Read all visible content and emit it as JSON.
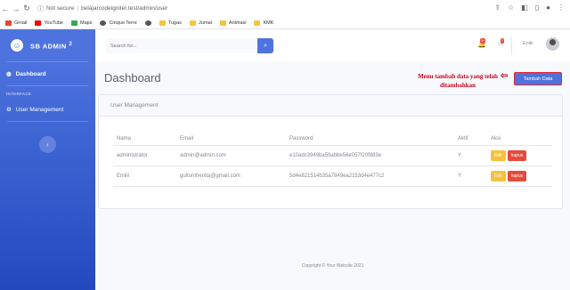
{
  "browser": {
    "security_label": "Not secure",
    "url": "belajarcodeigniter.test/admin/user",
    "bookmarks": [
      "Gmail",
      "YouTube",
      "Maps",
      "Cinque Terre",
      "Tugas",
      "Jurnal",
      "Animasi",
      "KMK"
    ]
  },
  "sidebar": {
    "brand": "SB ADMIN",
    "brand_sup": "2",
    "nav_dashboard": "Dashboard",
    "heading": "INTERFACE",
    "nav_user_management": "User Management"
  },
  "topbar": {
    "search_placeholder": "Search for...",
    "alerts_badge": "3+",
    "messages_badge": "7",
    "username": "Eniiii"
  },
  "main": {
    "title": "Dashboard",
    "add_button": "Tambah Data",
    "annotation": "Menu tambah data yang telah ditambahkan",
    "card_title": "User Management",
    "columns": [
      "Nama",
      "Email",
      "Password",
      "Aktif",
      "Aksi"
    ],
    "rows": [
      {
        "nama": "administrator",
        "email": "admin@admin.com",
        "password": "e10adc3949ba59abbe56e057f20f883e",
        "aktif": "Y",
        "edit": "Edit",
        "hapus": "hapus"
      },
      {
        "nama": "Eniiiii",
        "email": "gultomhenita@gmail.com",
        "password": "5d4e821514b35a7849ea2153d4e477c2",
        "aktif": "Y",
        "edit": "Edit",
        "hapus": "hapus"
      }
    ]
  },
  "footer": "Copyright © Your Website 2021",
  "colors": {
    "primary": "#4e73df",
    "warning": "#f6c23e",
    "danger": "#e74a3b",
    "annotation": "#d0021b"
  }
}
